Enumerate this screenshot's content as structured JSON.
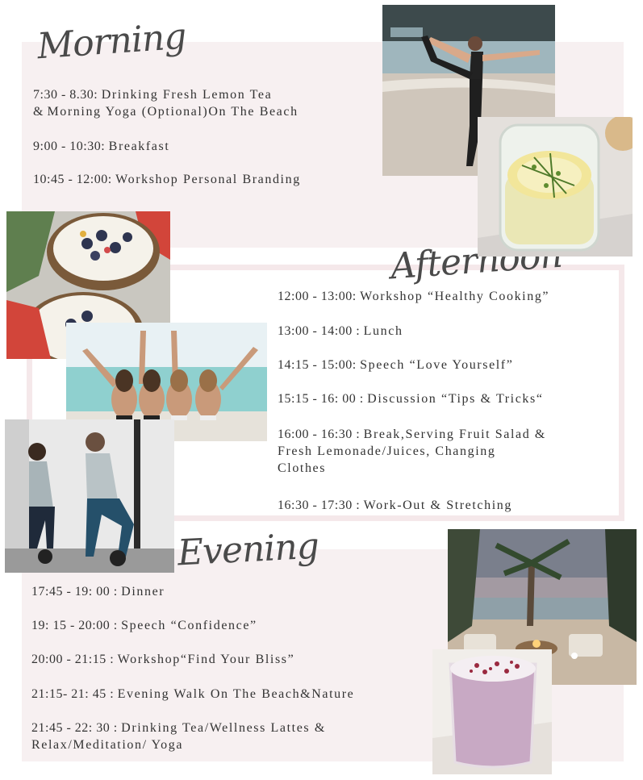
{
  "morning": {
    "title": "Morning",
    "items": [
      {
        "time": "7:30 - 8.30: ",
        "text": "Drinking Fresh Lemon Tea"
      },
      {
        "time": " & ",
        "text": "Morning Yoga (Optional)On The Beach"
      },
      {
        "time": "9:00 - 10:30: ",
        "text": "Breakfast"
      },
      {
        "time": "10:45 -  12:00: ",
        "text": "Workshop Personal Branding"
      }
    ]
  },
  "afternoon": {
    "title": "Afternoon",
    "items": [
      {
        "time": "12:00 - 13:00: ",
        "text": "Workshop “Healthy Cooking”"
      },
      {
        "time": "13:00 - 14:00 : ",
        "text": "Lunch"
      },
      {
        "time": "14:15 - 15:00: ",
        "text": "Speech “Love Yourself”"
      },
      {
        "time": "15:15 - 16: 00 : ",
        "text": "Discussion “Tips & Tricks“"
      },
      {
        "time": "16:00 - 16:30 : ",
        "text": "Break,Serving Fruit Salad &"
      },
      {
        "time": "",
        "text": "Fresh Lemonade/Juices, Changing"
      },
      {
        "time": "",
        "text": "Clothes"
      },
      {
        "time": "16:30 - 17:30  : ",
        "text": "Work-Out & Stretching"
      }
    ]
  },
  "evening": {
    "title": "Evening",
    "items": [
      {
        "time": "17:45 - 19: 00 :  ",
        "text": "Dinner"
      },
      {
        "time": "19: 15 - 20:00 : ",
        "text": "Speech “Confidence”"
      },
      {
        "time": "20:00 - 21:15 : ",
        "text": "Workshop“Find Your Bliss”"
      },
      {
        "time": "21:15- 21: 45 : ",
        "text": "Evening Walk On The Beach&Nature"
      },
      {
        "time": "21:45 - 22: 30 : ",
        "text": "Drinking Tea/Wellness Lattes &"
      },
      {
        "time": "",
        "text": "Relax/Meditation/ Yoga"
      }
    ]
  },
  "photos": [
    {
      "name": "yoga-beach-photo",
      "subject": "woman doing yoga pose on beach"
    },
    {
      "name": "lemon-tea-photo",
      "subject": "glass of lemon tea with thyme"
    },
    {
      "name": "smoothie-bowl-photo",
      "subject": "coconut bowls with berries and hibiscus"
    },
    {
      "name": "friends-beach-photo",
      "subject": "four women on the beach with arms raised"
    },
    {
      "name": "workout-photo",
      "subject": "two women doing kettlebell squats"
    },
    {
      "name": "beach-dinner-photo",
      "subject": "beach lounge with palm trees at dusk"
    },
    {
      "name": "latte-photo",
      "subject": "pink latte topped with rose petals"
    }
  ]
}
